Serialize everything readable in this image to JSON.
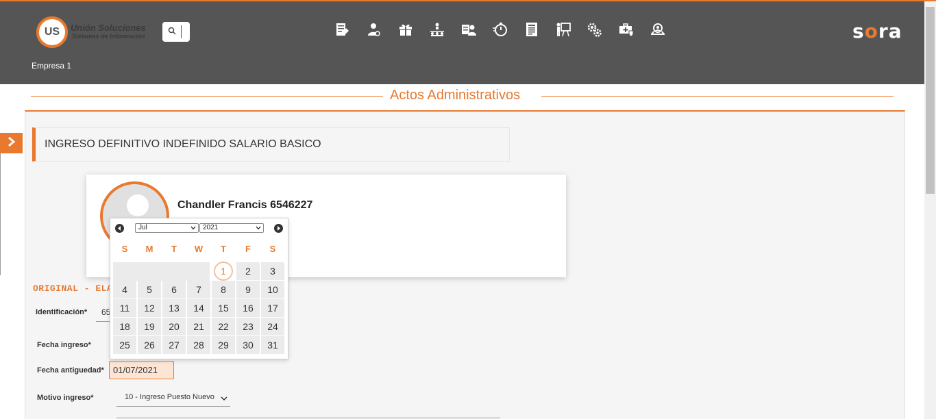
{
  "header": {
    "logo_mark": "US",
    "logo_title": "Unión Soluciones",
    "logo_subtitle": "Sistemas de Información",
    "brand_pre": "s",
    "brand_o": "o",
    "brand_post": "ra",
    "company": "Empresa 1",
    "icons": [
      "edit-document-icon",
      "user-settings-icon",
      "gift-icon",
      "org-chart-icon",
      "user-id-icon",
      "timer-icon",
      "report-icon",
      "presentation-icon",
      "gears-icon",
      "medical-case-icon",
      "user-search-icon"
    ]
  },
  "page": {
    "title": "Actos Administrativos"
  },
  "act": {
    "title": "INGRESO DEFINITIVO INDEFINIDO SALARIO BASICO"
  },
  "person": {
    "name": "Chandler Francis 6546227"
  },
  "form": {
    "section_label": "ORIGINAL - ELAB",
    "identificacion_label": "Identificación*",
    "identificacion_value": "65",
    "fecha_ingreso_label": "Fecha ingreso",
    "fecha_antiguedad_label": "Fecha antiguedad",
    "fecha_antiguedad_value": "01/07/2021",
    "motivo_label": "Motivo ingreso",
    "motivo_value": "10 - Ingreso Puesto Nuevo",
    "required_mark": "*"
  },
  "datepicker": {
    "month": "Jul",
    "year": "2021",
    "weekdays": [
      "S",
      "M",
      "T",
      "W",
      "T",
      "F",
      "S"
    ],
    "selected_day": "1",
    "days": [
      "1",
      "2",
      "3",
      "4",
      "5",
      "6",
      "7",
      "8",
      "9",
      "10",
      "11",
      "12",
      "13",
      "14",
      "15",
      "16",
      "17",
      "18",
      "19",
      "20",
      "21",
      "22",
      "23",
      "24",
      "25",
      "26",
      "27",
      "28",
      "29",
      "30",
      "31"
    ]
  },
  "colors": {
    "accent": "#e8792f",
    "header_bg": "#555555"
  }
}
